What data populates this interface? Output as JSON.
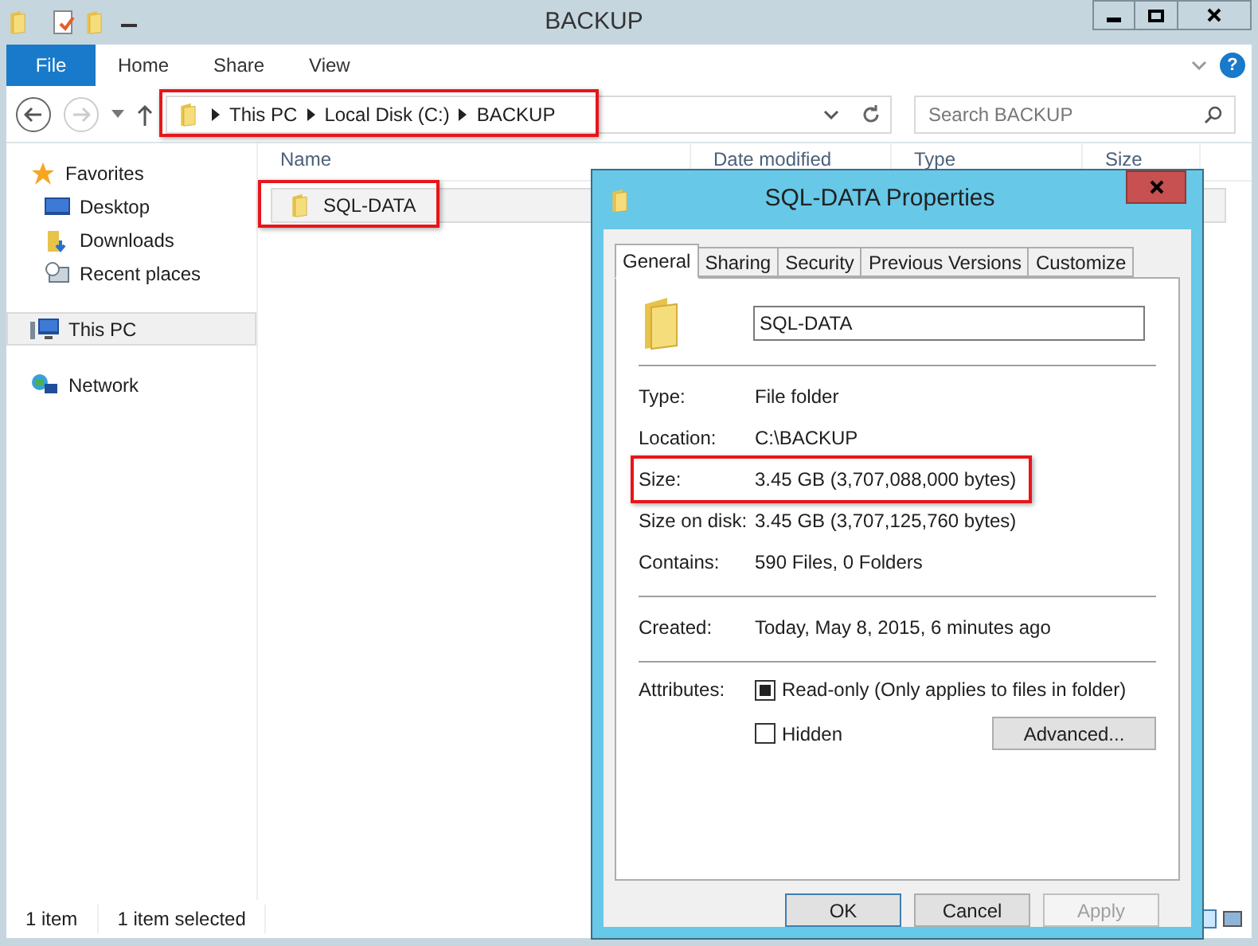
{
  "window": {
    "title": "BACKUP"
  },
  "ribbon_tabs": [
    {
      "label": "File",
      "selected": true
    },
    {
      "label": "Home",
      "selected": false
    },
    {
      "label": "Share",
      "selected": false
    },
    {
      "label": "View",
      "selected": false
    }
  ],
  "address_bar": {
    "highlighted": true,
    "crumbs": [
      "This PC",
      "Local Disk (C:)",
      "BACKUP"
    ]
  },
  "search": {
    "placeholder": "Search BACKUP"
  },
  "help": "?",
  "nav_pane": [
    {
      "label": "Favorites",
      "selected": false,
      "children": [
        {
          "label": "Desktop",
          "selected": false
        },
        {
          "label": "Downloads",
          "selected": false
        },
        {
          "label": "Recent places",
          "selected": false
        }
      ]
    },
    {
      "label": "This PC",
      "selected": true
    },
    {
      "label": "Network",
      "selected": false
    }
  ],
  "columns": [
    "Name",
    "Date modified",
    "Type",
    "Size"
  ],
  "files": [
    {
      "name": "SQL-DATA",
      "selected": true,
      "highlighted": true
    }
  ],
  "status_bar": [
    "1 item",
    "1 item selected"
  ],
  "dialog": {
    "title": "SQL-DATA Properties",
    "tabs": [
      {
        "label": "General",
        "selected": true
      },
      {
        "label": "Sharing",
        "selected": false
      },
      {
        "label": "Security",
        "selected": false
      },
      {
        "label": "Previous Versions",
        "selected": false
      },
      {
        "label": "Customize",
        "selected": false
      }
    ],
    "name_value": "SQL-DATA",
    "groups": [
      [
        {
          "label": "Type:",
          "value": "File folder",
          "highlighted": false
        },
        {
          "label": "Location:",
          "value": "C:\\BACKUP",
          "highlighted": false
        },
        {
          "label": "Size:",
          "value": "3.45 GB (3,707,088,000 bytes)",
          "highlighted": true
        },
        {
          "label": "Size on disk:",
          "value": "3.45 GB (3,707,125,760 bytes)",
          "highlighted": false
        },
        {
          "label": "Contains:",
          "value": "590 Files, 0 Folders",
          "highlighted": false
        }
      ],
      [
        {
          "label": "Created:",
          "value": "Today, May 8, 2015, 6 minutes ago",
          "highlighted": false
        }
      ]
    ],
    "attributes_label": "Attributes:",
    "attributes": [
      {
        "label": "Read-only (Only applies to files in folder)",
        "checked": false,
        "indeterminate": true
      },
      {
        "label": "Hidden",
        "checked": false,
        "indeterminate": false
      }
    ],
    "advanced_button": "Advanced...",
    "buttons": [
      {
        "label": "OK",
        "disabled": false,
        "default": true
      },
      {
        "label": "Cancel",
        "disabled": false,
        "default": false
      },
      {
        "label": "Apply",
        "disabled": true,
        "default": false
      }
    ]
  }
}
